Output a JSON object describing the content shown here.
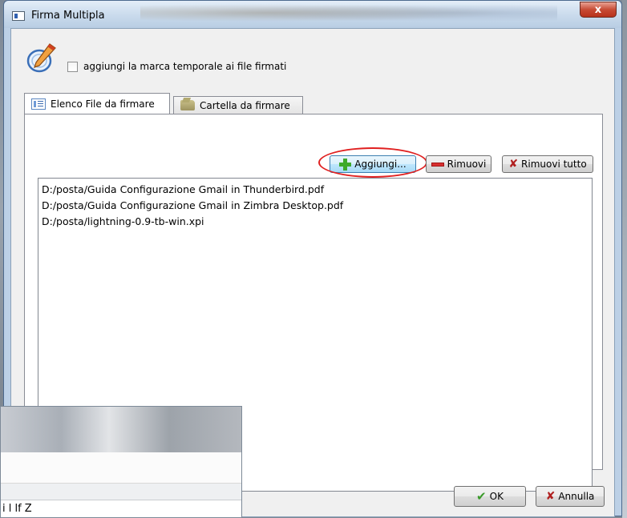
{
  "window": {
    "title": "Firma Multipla",
    "close_label": "x"
  },
  "options": {
    "timestamp_checkbox_label": "aggiungi la marca temporale ai file firmati",
    "timestamp_checked": false
  },
  "tabs": [
    {
      "label": "Elenco File da firmare",
      "active": true,
      "icon": "list-icon"
    },
    {
      "label": "Cartella da firmare",
      "active": false,
      "icon": "folder-icon"
    }
  ],
  "toolbar": {
    "add_label": "Aggiungi...",
    "remove_label": "Rimuovi",
    "remove_all_label": "Rimuovi tutto"
  },
  "files": [
    "D:/posta/Guida Configurazione Gmail in Thunderbird.pdf",
    "D:/posta/Guida Configurazione Gmail in Zimbra Desktop.pdf",
    "D:/posta/lightning-0.9-tb-win.xpi"
  ],
  "footer": {
    "ok_label": "OK",
    "cancel_label": "Annulla"
  },
  "overlay_window": {
    "partial_text": "i l   lf  Z"
  },
  "colors": {
    "highlight": "#e02020",
    "add_icon": "#3daa2c",
    "remove_icon": "#d83030"
  }
}
